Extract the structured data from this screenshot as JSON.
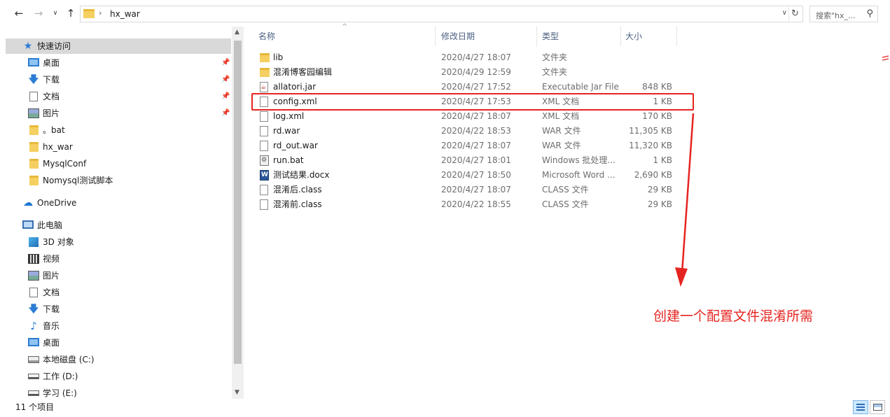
{
  "address": {
    "crumb": "hx_war",
    "search_placeholder": "搜索\"hx_...",
    "icons": {
      "back": "arrow-left-icon",
      "forward": "arrow-right-icon",
      "recent": "chevron-down-icon",
      "up": "arrow-up-icon",
      "refresh": "refresh-icon",
      "search": "magnifier-icon"
    }
  },
  "sidebar": {
    "quick_access": {
      "label": "快速访问",
      "icon": "star-icon"
    },
    "pinned": [
      {
        "label": "桌面",
        "icon": "desktop-icon"
      },
      {
        "label": "下载",
        "icon": "download-icon"
      },
      {
        "label": "文档",
        "icon": "document-icon"
      },
      {
        "label": "图片",
        "icon": "pictures-icon"
      }
    ],
    "recent_folders": [
      {
        "label": "。bat"
      },
      {
        "label": "hx_war"
      },
      {
        "label": "MysqlConf"
      },
      {
        "label": "Nomysql测试脚本"
      }
    ],
    "onedrive": {
      "label": "OneDrive",
      "icon": "cloud-icon"
    },
    "this_pc": {
      "label": "此电脑",
      "icon": "computer-icon"
    },
    "pc_items": [
      {
        "label": "3D 对象",
        "icon": "cube-icon"
      },
      {
        "label": "视频",
        "icon": "video-icon"
      },
      {
        "label": "图片",
        "icon": "pictures-icon"
      },
      {
        "label": "文档",
        "icon": "document-icon"
      },
      {
        "label": "下载",
        "icon": "download-icon"
      },
      {
        "label": "音乐",
        "icon": "music-icon"
      },
      {
        "label": "桌面",
        "icon": "desktop-icon"
      },
      {
        "label": "本地磁盘 (C:)",
        "icon": "system-drive-icon"
      },
      {
        "label": "工作 (D:)",
        "icon": "drive-icon"
      },
      {
        "label": "学习 (E:)",
        "icon": "drive-icon"
      }
    ]
  },
  "columns": {
    "name": "名称",
    "modified": "修改日期",
    "type": "类型",
    "size": "大小"
  },
  "files": [
    {
      "name": "lib",
      "date": "2020/4/27 18:07",
      "type": "文件夹",
      "size": "",
      "icon": "folder"
    },
    {
      "name": "混淆博客园编辑",
      "date": "2020/4/29 12:59",
      "type": "文件夹",
      "size": "",
      "icon": "folder"
    },
    {
      "name": "allatori.jar",
      "date": "2020/4/27 17:52",
      "type": "Executable Jar File",
      "size": "848 KB",
      "icon": "jar"
    },
    {
      "name": "config.xml",
      "date": "2020/4/27 17:53",
      "type": "XML 文档",
      "size": "1 KB",
      "icon": "file"
    },
    {
      "name": "log.xml",
      "date": "2020/4/27 18:07",
      "type": "XML 文档",
      "size": "170 KB",
      "icon": "file"
    },
    {
      "name": "rd.war",
      "date": "2020/4/22 18:53",
      "type": "WAR 文件",
      "size": "11,305 KB",
      "icon": "file"
    },
    {
      "name": "rd_out.war",
      "date": "2020/4/27 18:07",
      "type": "WAR 文件",
      "size": "11,320 KB",
      "icon": "file"
    },
    {
      "name": "run.bat",
      "date": "2020/4/27 18:01",
      "type": "Windows 批处理...",
      "size": "1 KB",
      "icon": "bat"
    },
    {
      "name": "测试结果.docx",
      "date": "2020/4/27 18:50",
      "type": "Microsoft Word ...",
      "size": "2,690 KB",
      "icon": "word"
    },
    {
      "name": "混淆后.class",
      "date": "2020/4/27 18:07",
      "type": "CLASS 文件",
      "size": "29 KB",
      "icon": "file"
    },
    {
      "name": "混淆前.class",
      "date": "2020/4/22 18:55",
      "type": "CLASS 文件",
      "size": "29 KB",
      "icon": "file"
    }
  ],
  "annotation": {
    "text": "创建一个配置文件混淆所需",
    "color": "#e52420"
  },
  "status": {
    "count": "11 个项目"
  },
  "colors": {
    "selection": "#d9d9d9",
    "header_text": "#4d6082",
    "accent": "#2b7cd3",
    "annotation": "#e52420"
  }
}
